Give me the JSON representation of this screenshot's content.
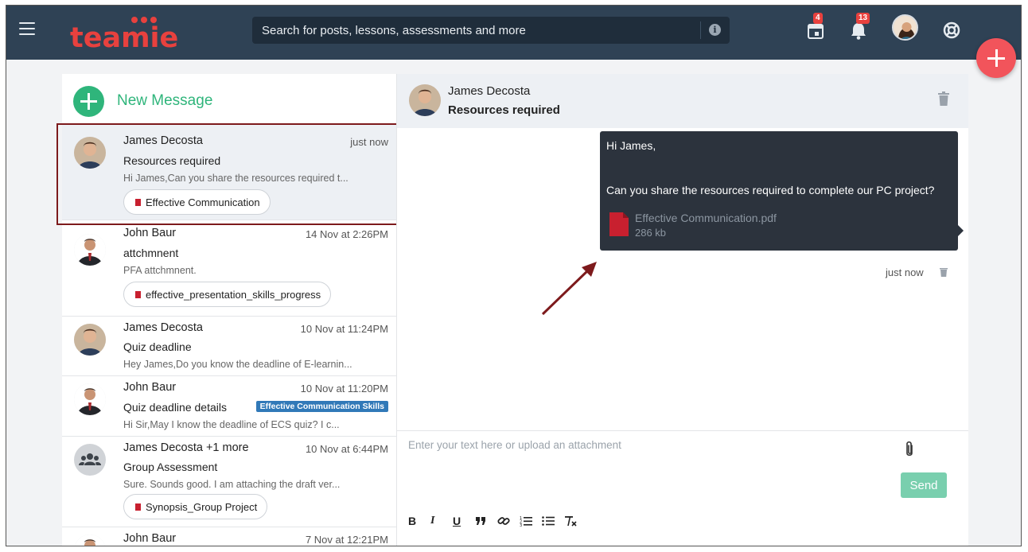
{
  "topbar": {
    "brand": "teamie",
    "search": {
      "placeholder": "Search for posts, lessons, assessments and more"
    },
    "calendar_badge": "4",
    "notifications_badge": "13"
  },
  "sidebar": {
    "new_message_label": "New Message",
    "messages": [
      {
        "name": "James Decosta",
        "time": "just now",
        "subject": "Resources required",
        "snippet": "Hi James,Can you share the resources required t...",
        "attachment": "Effective Communication",
        "selected": true
      },
      {
        "name": "John Baur",
        "time": "14 Nov at 2:26PM",
        "subject": "attchmnent",
        "snippet": "PFA attchmnent.",
        "attachment": "effective_presentation_skills_progress"
      },
      {
        "name": "James Decosta",
        "time": "10 Nov at 11:24PM",
        "subject": "Quiz deadline",
        "snippet": "Hey James,Do you know the deadline of E-learnin..."
      },
      {
        "name": "John Baur",
        "time": "10 Nov at 11:20PM",
        "subject": "Quiz deadline details",
        "snippet": "Hi Sir,May I know the deadline of ECS quiz? I c...",
        "tag": "Effective Communication Skills"
      },
      {
        "name": "James Decosta +1 more",
        "time": "10 Nov at 6:44PM",
        "subject": "Group Assessment",
        "snippet": "Sure. Sounds good. I am attaching the draft ver...",
        "attachment": "Synopsis_Group Project"
      },
      {
        "name": "John Baur",
        "time": "7 Nov at 12:21PM",
        "subject": "",
        "snippet": ""
      }
    ]
  },
  "thread": {
    "name": "James Decosta",
    "subject": "Resources required",
    "message": {
      "greeting": "Hi James,",
      "body": "Can you share the resources required to complete our PC project?",
      "file_name": "Effective Communication.pdf",
      "file_size": "286 kb",
      "time": "just now"
    }
  },
  "compose": {
    "placeholder": "Enter your text here or upload an attachment",
    "send_label": "Send"
  },
  "colors": {
    "topbar": "#2f4255",
    "accent_green": "#2fb57b",
    "fab": "#f2545b",
    "highlight_border": "#7d1a1c",
    "bubble": "#2c333d",
    "tag": "#3179b8"
  }
}
